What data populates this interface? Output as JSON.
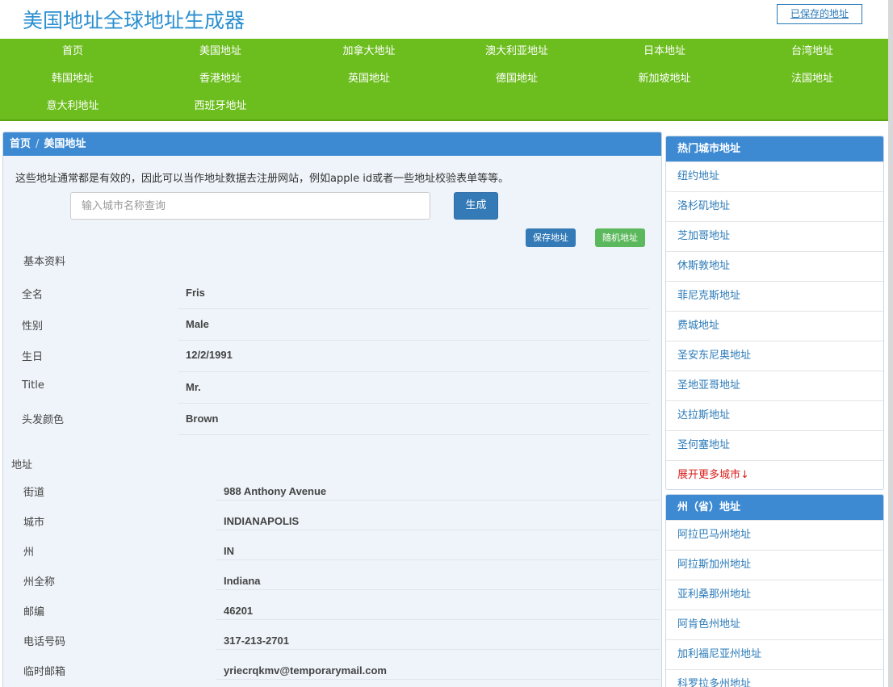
{
  "site": {
    "title": "美国地址全球地址生成器",
    "saved_link": "已保存的地址"
  },
  "nav": [
    "首页",
    "美国地址",
    "加拿大地址",
    "澳大利亚地址",
    "日本地址",
    "台湾地址",
    "韩国地址",
    "香港地址",
    "英国地址",
    "德国地址",
    "新加坡地址",
    "法国地址",
    "意大利地址",
    "西班牙地址"
  ],
  "breadcrumb": {
    "home": "首页",
    "separator": "/",
    "current": "美国地址"
  },
  "intro": "这些地址通常都是有效的，因此可以当作地址数据去注册网站，例如apple id或者一些地址校验表单等等。",
  "search": {
    "placeholder": "输入城市名称查询",
    "value": "",
    "generate": "生成"
  },
  "actions": {
    "save": "保存地址",
    "random": "随机地址"
  },
  "basic": {
    "heading": "基本资料",
    "rows": [
      {
        "label": "全名",
        "value": "Fris"
      },
      {
        "label": "性别",
        "value": "Male"
      },
      {
        "label": "生日",
        "value": "12/2/1991"
      },
      {
        "label": "Title",
        "value": "Mr."
      },
      {
        "label": "头发颜色",
        "value": "Brown"
      }
    ]
  },
  "address": {
    "heading": "地址",
    "rows": [
      {
        "label": "街道",
        "value": "988  Anthony Avenue"
      },
      {
        "label": "城市",
        "value": "INDIANAPOLIS"
      },
      {
        "label": "州",
        "value": "IN"
      },
      {
        "label": "州全称",
        "value": "Indiana"
      },
      {
        "label": "邮编",
        "value": "46201"
      },
      {
        "label": "电话号码",
        "value": "317-213-2701"
      },
      {
        "label": "临时邮箱",
        "value": "yriecrqkmv@temporarymail.com"
      }
    ]
  },
  "sidebar": {
    "cities": {
      "heading": "热门城市地址",
      "items": [
        "纽约地址",
        "洛杉矶地址",
        "芝加哥地址",
        "休斯敦地址",
        "菲尼克斯地址",
        "费城地址",
        "圣安东尼奥地址",
        "圣地亚哥地址",
        "达拉斯地址",
        "圣何塞地址"
      ],
      "more": "展开更多城市↓"
    },
    "states": {
      "heading": "州（省）地址",
      "items": [
        "阿拉巴马州地址",
        "阿拉斯加州地址",
        "亚利桑那州地址",
        "阿肯色州地址",
        "加利福尼亚州地址",
        "科罗拉多州地址"
      ]
    }
  },
  "colors": {
    "nav_green": "#6cbd1e",
    "header_blue": "#3d8ad3",
    "title_blue": "#2a8fd0",
    "link_blue": "#2a7ab8",
    "more_red": "#d9201e"
  }
}
